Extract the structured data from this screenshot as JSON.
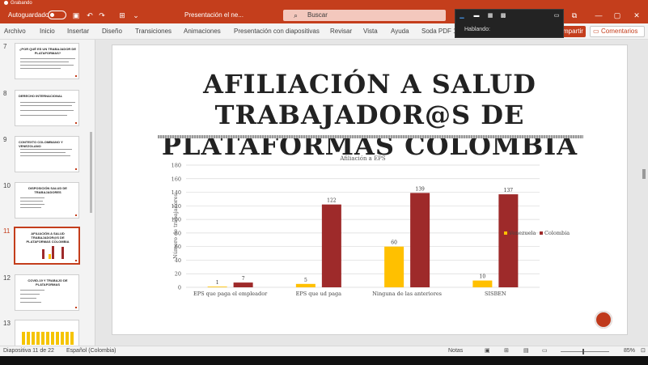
{
  "recording": {
    "label": "Grabando"
  },
  "titlebar": {
    "autosave_label": "Autoguardado",
    "doc_title": "Presentación el ne...",
    "search_placeholder": "Buscar"
  },
  "floating_panel": {
    "speaking_label": "Hablando:"
  },
  "ribbon": {
    "tabs": [
      "Archivo",
      "Inicio",
      "Insertar",
      "Diseño",
      "Transiciones",
      "Animaciones",
      "Presentación con diapositivas",
      "Revisar",
      "Vista",
      "Ayuda",
      "Soda PDF 1"
    ],
    "share_label": "mpartir",
    "comments_label": "Comentarios"
  },
  "thumbnails": [
    {
      "num": "7",
      "title": "¿POR QUÉ ES UN TRABAJADOR DE PLATAFORMAS?"
    },
    {
      "num": "8",
      "title": "DERECHO INTERNACIONAL"
    },
    {
      "num": "9",
      "title": "CONTEXTO COLOMBIANO Y VENEZOLANO"
    },
    {
      "num": "10",
      "title": "DISPOSICIÓN SALUD DE TRABAJADORES"
    },
    {
      "num": "11",
      "title": "AFILIACIÓN A SALUD TRABAJADOR@S DE PLATAFORMAS COLOMBIA",
      "selected": true
    },
    {
      "num": "12",
      "title": "COVID-19 Y TRABAJO DE PLATAFORMAS"
    },
    {
      "num": "13",
      "title": ""
    }
  ],
  "slide": {
    "title_line1": "AFILIACIÓN A SALUD TRABAJADOR@S DE",
    "title_line2": "PLATAFORMAS COLOMBIA"
  },
  "chart_data": {
    "type": "bar",
    "title": "Afiliación a EPS",
    "ylabel": "Número de trabajadores",
    "xlabel": "",
    "ylim": [
      0,
      180
    ],
    "yticks": [
      0,
      20,
      40,
      60,
      80,
      100,
      120,
      140,
      160,
      180
    ],
    "categories": [
      "EPS que paga el empleador",
      "EPS que ud paga",
      "Ninguna de las anteriores",
      "SISBEN"
    ],
    "series": [
      {
        "name": "Venezuela",
        "color": "#ffc000",
        "values": [
          1,
          5,
          60,
          10
        ]
      },
      {
        "name": "Colombia",
        "color": "#9e2a2a",
        "values": [
          7,
          122,
          139,
          137
        ]
      }
    ],
    "grid": true,
    "legend": "right"
  },
  "status": {
    "slide_info": "Diapositiva 11 de 22",
    "language": "Español (Colombia)",
    "notes": "Notas",
    "zoom": "85%"
  },
  "colors": {
    "accent": "#c43e1c"
  }
}
